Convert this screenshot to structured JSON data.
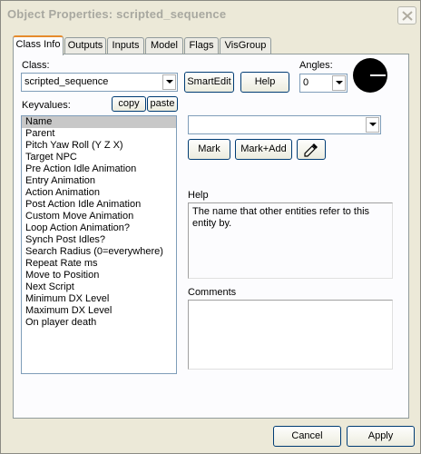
{
  "window": {
    "title": "Object Properties: scripted_sequence"
  },
  "tabs": [
    {
      "label": "Class Info",
      "active": true
    },
    {
      "label": "Outputs",
      "active": false
    },
    {
      "label": "Inputs",
      "active": false
    },
    {
      "label": "Model",
      "active": false
    },
    {
      "label": "Flags",
      "active": false
    },
    {
      "label": "VisGroup",
      "active": false
    }
  ],
  "class_section": {
    "label": "Class:",
    "value": "scripted_sequence",
    "smartedit_label": "SmartEdit",
    "help_label": "Help"
  },
  "angles": {
    "label": "Angles:",
    "value": "0"
  },
  "keyvalues": {
    "label": "Keyvalues:",
    "copy_label": "copy",
    "paste_label": "paste",
    "items": [
      "Name",
      "Parent",
      "Pitch Yaw Roll (Y Z X)",
      "Target NPC",
      "Pre Action Idle Animation",
      "Entry Animation",
      "Action Animation",
      "Post Action Idle Animation",
      "Custom Move Animation",
      "Loop Action Animation?",
      "Synch Post Idles?",
      "Search Radius (0=everywhere)",
      "Repeat Rate ms",
      "Move to Position",
      "Next Script",
      "Minimum DX Level",
      "Maximum DX Level",
      "On player death"
    ],
    "selected_index": 0
  },
  "value_editor": {
    "value": "",
    "mark_label": "Mark",
    "mark_add_label": "Mark+Add"
  },
  "help": {
    "label": "Help",
    "text": "The name that other entities refer to this entity by."
  },
  "comments": {
    "label": "Comments",
    "text": ""
  },
  "footer": {
    "cancel_label": "Cancel",
    "apply_label": "Apply"
  },
  "icons": {
    "close": "close-icon",
    "eyedropper": "eyedropper-icon",
    "dropdown": "chevron-down-icon",
    "angle_gauge": "angle-gauge-icon"
  },
  "colors": {
    "window_bg": "#ece9d8",
    "panel_bg": "#fcfcfe",
    "active_tab_accent": "#e68b2c",
    "list_selection": "#c8c8c8",
    "title_text": "#a8a8a0"
  }
}
